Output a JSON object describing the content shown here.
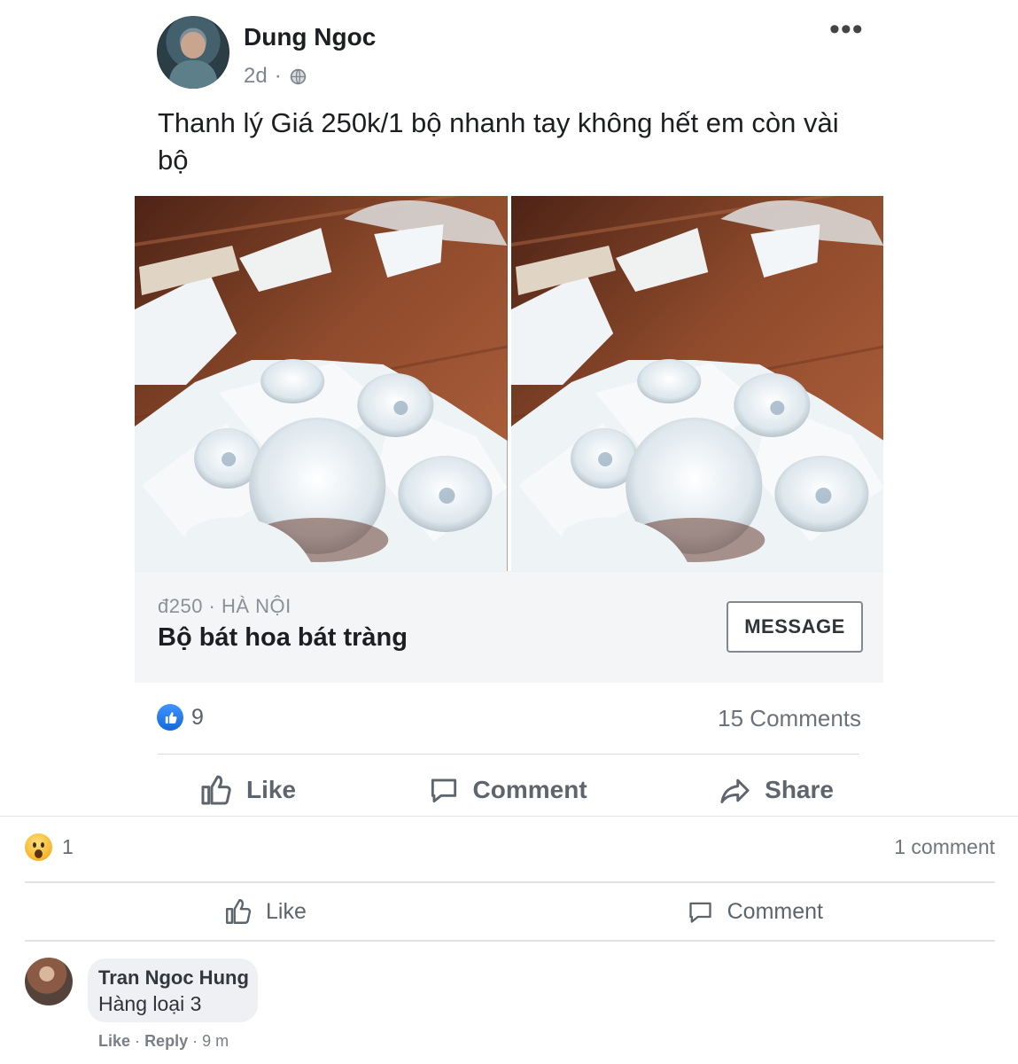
{
  "post": {
    "author": "Dung Ngoc",
    "timestamp": "2d",
    "meta_separator": "·",
    "text": "Thanh lý  Giá 250k/1 bộ nhanh tay không hết em còn vài bộ",
    "icons": {
      "privacy": "globe-icon",
      "menu": "more-options-icon"
    }
  },
  "marketplace": {
    "price_location": "đ250 · HÀ NỘI",
    "title": "Bộ bát hoa bát tràng",
    "message_button": "MESSAGE"
  },
  "engagement": {
    "likes": "9",
    "comments": "15 Comments"
  },
  "post_actions": {
    "like": "Like",
    "comment": "Comment",
    "share": "Share"
  },
  "comment_section": {
    "reaction_count": "1",
    "comment_count": "1 comment",
    "like_label": "Like",
    "comment_label": "Comment"
  },
  "comment": {
    "author": "Tran Ngoc Hung",
    "text": "Hàng loại 3",
    "like_link": "Like",
    "reply_link": "Reply",
    "separator": "·",
    "time": "9 m"
  },
  "colors": {
    "facebook_blue": "#1877f2",
    "marketplace_background": "#f4f5f7",
    "comment_bubble": "#eef0f3"
  }
}
